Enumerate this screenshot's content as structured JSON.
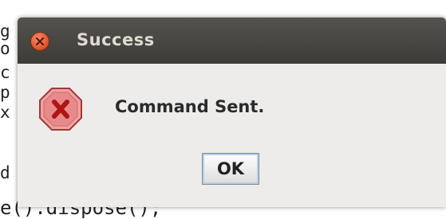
{
  "background_code": {
    "left_fragments": [
      "g",
      "o",
      "c",
      "p",
      "x",
      "",
      "d"
    ],
    "bottom_line": "e().dispose();"
  },
  "dialog": {
    "title": "Success",
    "message": "Command Sent.",
    "ok_label": "OK",
    "icons": {
      "close": "close-icon",
      "error": "error-icon"
    },
    "colors": {
      "titlebar": "#45433f",
      "close": "#e25a30",
      "error_fill": "#e88a8a",
      "error_glyph": "#b01515",
      "body": "#edecea"
    }
  }
}
